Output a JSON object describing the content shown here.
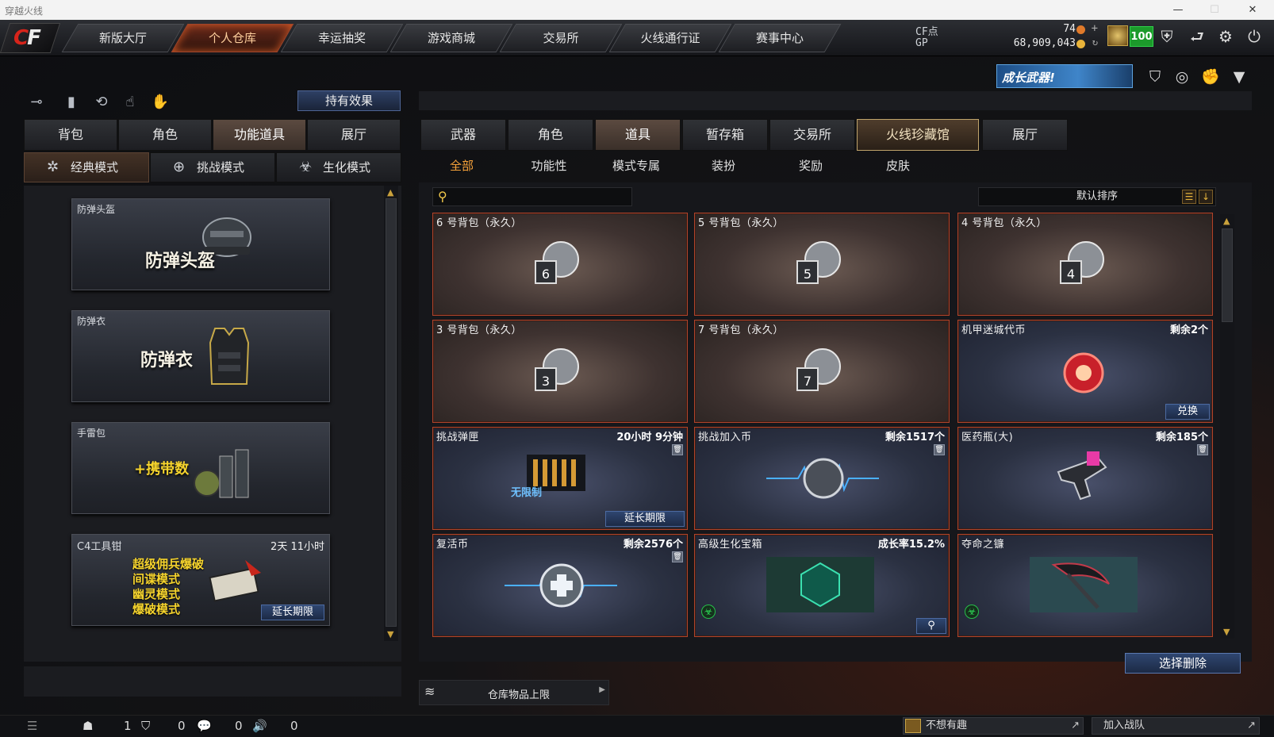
{
  "window": {
    "title": "穿越火线"
  },
  "logo": {
    "text": "CF"
  },
  "nav": {
    "tabs": [
      {
        "label": "新版大厅"
      },
      {
        "label": "个人仓库",
        "active": true
      },
      {
        "label": "幸运抽奖"
      },
      {
        "label": "游戏商城"
      },
      {
        "label": "交易所"
      },
      {
        "label": "火线通行证"
      },
      {
        "label": "赛事中心"
      }
    ]
  },
  "currency": {
    "cf_label": "CF点",
    "cf_value": "74",
    "gp_label": "GP",
    "gp_value": "68,909,043",
    "level": "100",
    "coin_cf_color": "#e07a2a",
    "coin_gp_color": "#e8b33a"
  },
  "growth": {
    "label": "成长武器!"
  },
  "left": {
    "effect_button": "持有效果",
    "tabs": [
      "背包",
      "角色",
      "功能道具",
      "展厅"
    ],
    "active_tab": "功能道具",
    "modes": [
      {
        "label": "经典模式",
        "icon": "star-burst-icon",
        "active": true
      },
      {
        "label": "挑战模式",
        "icon": "challenge-icon"
      },
      {
        "label": "生化模式",
        "icon": "biohazard-icon"
      }
    ],
    "items": [
      {
        "title": "防弹头盔",
        "big": "防弹头盔",
        "icon": "helmet-icon"
      },
      {
        "title": "防弹衣",
        "big": "防弹衣",
        "icon": "vest-icon"
      },
      {
        "title": "手雷包",
        "big": "+携带数",
        "icon": "grenade-icon"
      },
      {
        "title": "C4工具钳",
        "right": "2天 11小时",
        "lines": [
          "超级佣兵爆破",
          "间谍模式",
          "幽灵模式",
          "爆破模式"
        ],
        "button": "延长期限",
        "icon": "c4-pliers-icon"
      }
    ]
  },
  "right": {
    "tabs": [
      "武器",
      "角色",
      "道具",
      "暂存箱",
      "交易所",
      "火线珍藏馆",
      "展厅"
    ],
    "active_tab": "道具",
    "subtabs": [
      "全部",
      "功能性",
      "模式专属",
      "装扮",
      "奖励",
      "皮肤"
    ],
    "active_subtab": "全部",
    "search_placeholder": "",
    "sort_label": "默认排序",
    "items": [
      {
        "title": "6 号背包（永久）",
        "bag": "6",
        "style": "brown"
      },
      {
        "title": "5 号背包（永久）",
        "bag": "5",
        "style": "brown"
      },
      {
        "title": "4 号背包（永久）",
        "bag": "4",
        "style": "brown"
      },
      {
        "title": "3 号背包（永久）",
        "bag": "3",
        "style": "brown"
      },
      {
        "title": "7 号背包（永久）",
        "bag": "7",
        "style": "brown"
      },
      {
        "title": "机甲迷城代币",
        "right": "剩余2个",
        "button": "兑换",
        "style": "blue",
        "icon": "token-icon"
      },
      {
        "title": "挑战弹匣",
        "right": "20小时 9分钟",
        "button": "延长期限",
        "style": "blue",
        "icon": "magazine-icon",
        "badge": "无限制"
      },
      {
        "title": "挑战加入币",
        "right": "剩余1517个",
        "style": "blue",
        "icon": "join-coin-icon"
      },
      {
        "title": "医药瓶(大)",
        "right": "剩余185个",
        "style": "blue",
        "icon": "medkit-gun-icon"
      },
      {
        "title": "复活币",
        "right": "剩余2576个",
        "style": "blue",
        "icon": "revive-coin-icon"
      },
      {
        "title": "高级生化宝箱",
        "right": "成长率15.2%",
        "style": "blue",
        "icon": "bio-chest-icon"
      },
      {
        "title": "夺命之镰",
        "style": "blue",
        "icon": "scythe-icon"
      }
    ],
    "select_delete": "选择删除",
    "storage_limit": "仓库物品上限"
  },
  "status": {
    "count1": "1",
    "count2": "0",
    "count3": "0",
    "count4": "0",
    "chat1": "不想有趣",
    "chat2": "加入战队"
  }
}
